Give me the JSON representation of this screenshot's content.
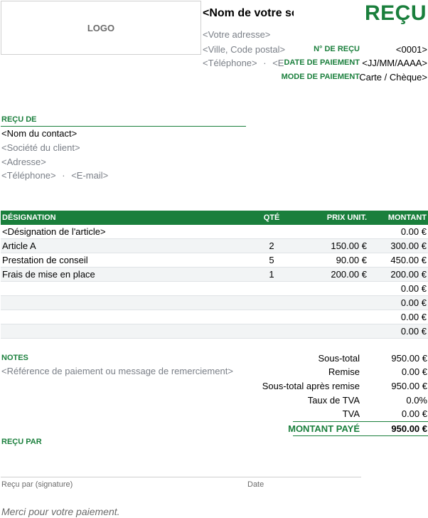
{
  "header": {
    "logo": "LOGO",
    "company_name": "<Nom de votre so",
    "address": "<Votre adresse>",
    "city": "<Ville, Code postal>",
    "phone": "<Téléphone>",
    "separator": "·",
    "email_partial": "<E",
    "title": "REÇU",
    "meta": [
      {
        "label": "N° DE REÇU",
        "value": "<0001>"
      },
      {
        "label": "DATE DE PAIEMENT",
        "value": "<JJ/MM/AAAA>"
      },
      {
        "label": "MODE DE PAIEMENT",
        "value": "Carte / Chèque>"
      }
    ]
  },
  "recipient": {
    "heading": "REÇU DE",
    "contact": "<Nom du contact>",
    "company": "<Société du client>",
    "address": "<Adresse>",
    "phone": "<Téléphone>",
    "separator": "·",
    "email": "<E-mail>"
  },
  "items": {
    "headers": {
      "desc": "DÉSIGNATION",
      "qty": "QTÉ",
      "price": "PRIX UNIT.",
      "amount": "MONTANT"
    },
    "rows": [
      {
        "desc": "<Désignation de l'article>",
        "qty": "",
        "price": "",
        "amount": "0.00 €"
      },
      {
        "desc": "Article A",
        "qty": "2",
        "price": "150.00 €",
        "amount": "300.00 €"
      },
      {
        "desc": "Prestation de conseil",
        "qty": "5",
        "price": "90.00 €",
        "amount": "450.00 €"
      },
      {
        "desc": "Frais de mise en place",
        "qty": "1",
        "price": "200.00 €",
        "amount": "200.00 €"
      },
      {
        "desc": "",
        "qty": "",
        "price": "",
        "amount": "0.00 €"
      },
      {
        "desc": "",
        "qty": "",
        "price": "",
        "amount": "0.00 €"
      },
      {
        "desc": "",
        "qty": "",
        "price": "",
        "amount": "0.00 €"
      },
      {
        "desc": "",
        "qty": "",
        "price": "",
        "amount": "0.00 €"
      }
    ]
  },
  "notes": {
    "heading": "NOTES",
    "text": "<Référence de paiement ou message de remerciement>"
  },
  "summary": {
    "subtotal_label": "Sous-total",
    "subtotal": "950.00 €",
    "discount_label": "Remise",
    "discount": "0.00 €",
    "subtotal_after_label": "Sous-total après remise",
    "subtotal_after": "950.00 €",
    "tax_rate_label": "Taux de TVA",
    "tax_rate": "0.0%",
    "tax_label": "TVA",
    "tax": "0.00 €",
    "total_label": "MONTANT PAYÉ",
    "total": "950.00 €"
  },
  "signature": {
    "heading": "REÇU PAR",
    "sign_label": "Reçu par (signature)",
    "date_label": "Date"
  },
  "footer": {
    "thanks": "Merci pour votre paiement."
  },
  "colors": {
    "accent": "#1a7f3c"
  }
}
